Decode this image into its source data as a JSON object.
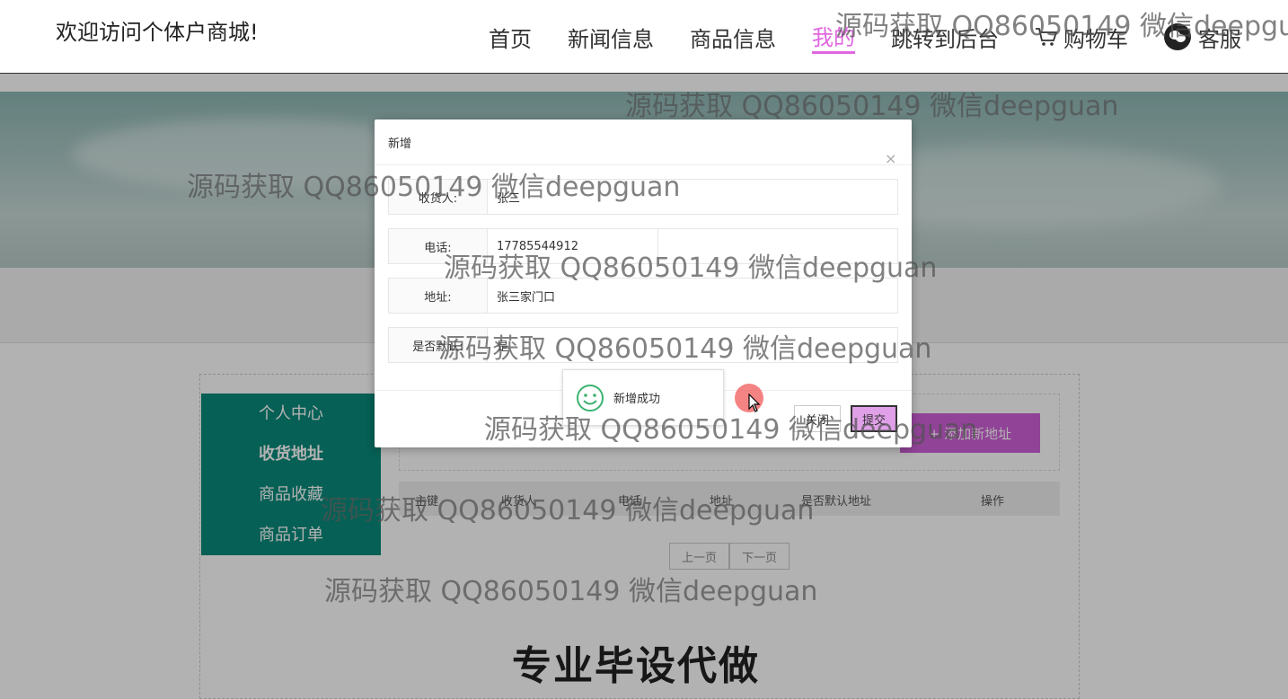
{
  "header": {
    "welcome": "欢迎访问个体户商城!",
    "nav": [
      {
        "label": "首页",
        "active": false
      },
      {
        "label": "新闻信息",
        "active": false
      },
      {
        "label": "商品信息",
        "active": false
      },
      {
        "label": "我的",
        "active": true
      },
      {
        "label": "跳转到后台",
        "active": false
      },
      {
        "label": "购物车",
        "active": false,
        "icon": "cart-icon"
      },
      {
        "label": "客服",
        "active": false,
        "icon": "wechat-icon"
      }
    ],
    "accent_color": "#e066e0"
  },
  "sidebar": {
    "items": [
      {
        "label": "个人中心"
      },
      {
        "label": "收货地址"
      },
      {
        "label": "商品收藏"
      },
      {
        "label": "商品订单"
      }
    ],
    "color": "#0a8a7a"
  },
  "page": {
    "add_button": "+ 添加新地址",
    "table_headers": [
      "主键",
      "收货人",
      "电话",
      "地址",
      "是否默认地址",
      "操作"
    ],
    "prev_page": "上一页",
    "next_page": "下一页",
    "promo": "专业毕设代做"
  },
  "modal": {
    "title": "新增",
    "close": "×",
    "fields": [
      {
        "label": "收货人:",
        "value": "张三"
      },
      {
        "label": "电话:",
        "value": "17785544912"
      },
      {
        "label": "地址:",
        "value": "张三家门口"
      },
      {
        "label": "是否默认:",
        "value": "是"
      }
    ],
    "close_button": "关闭",
    "submit_button": "提交"
  },
  "toast": {
    "message": "新增成功",
    "icon": "smile-icon"
  },
  "watermark": "源码获取 QQ86050149 微信deepguan"
}
